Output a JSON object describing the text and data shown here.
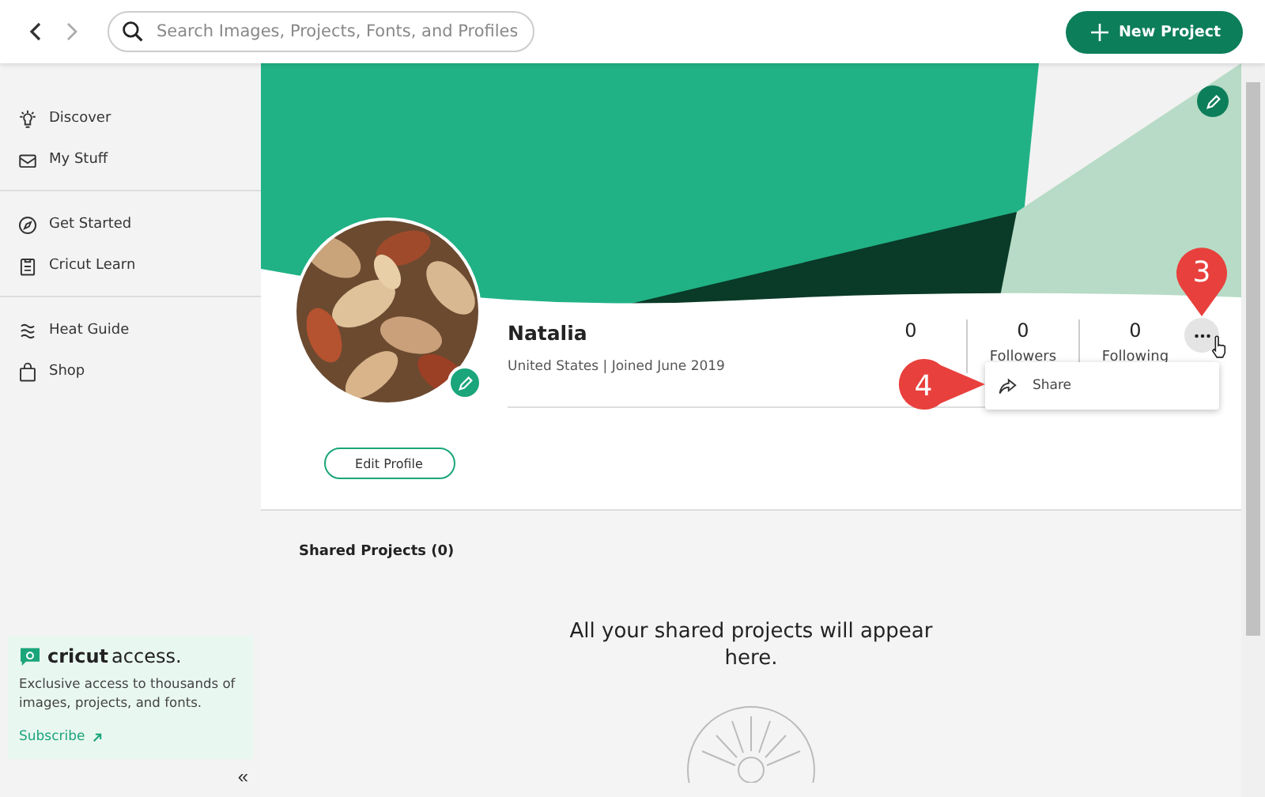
{
  "topbar": {
    "search": {
      "placeholder": "Search Images, Projects, Fonts, and Profiles"
    },
    "new_project_button": "New Project"
  },
  "sidebar": {
    "groups": [
      [
        {
          "label": "Discover",
          "kind": "bulb"
        },
        {
          "label": "My Stuff",
          "kind": "inbox"
        }
      ],
      [
        {
          "label": "Get Started",
          "kind": "compass"
        },
        {
          "label": "Cricut Learn",
          "kind": "clipboard"
        }
      ],
      [
        {
          "label": "Heat Guide",
          "kind": "waves"
        },
        {
          "label": "Shop",
          "kind": "bag"
        }
      ]
    ],
    "promo": {
      "brand": "cricut",
      "brand_suffix": "access.",
      "text": "Exclusive access to thousands of images, projects, and fonts.",
      "link": "Subscribe"
    },
    "collapse": "«"
  },
  "profile": {
    "name": "Natalia",
    "meta": "United States | Joined June 2019",
    "edit_button": "Edit Profile",
    "stats": [
      {
        "value": "0"
      },
      {
        "value": "0",
        "label": "Followers"
      },
      {
        "value": "0",
        "label": "Following"
      }
    ],
    "menu": {
      "items": [
        {
          "label": "Share"
        }
      ]
    }
  },
  "callouts": [
    {
      "number": "3"
    },
    {
      "number": "4"
    }
  ],
  "shared": {
    "heading": "Shared Projects (0)",
    "empty_message": "All your shared projects will appear here."
  }
}
